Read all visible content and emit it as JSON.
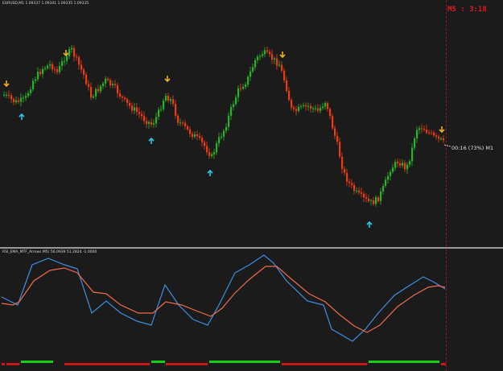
{
  "main_chart": {
    "title": "EURUSD,M1  1.09337 1.09341 1.09335 1.09335",
    "timer_label": "M5 : 3:18",
    "countdown_label": "00:16 (73%) M1"
  },
  "indicator": {
    "title": "RSI_EMA_MTF_Arrows M5) 56.0939 51.2824 -1.0000"
  },
  "colors": {
    "bull": "#27b427",
    "bear": "#ef3b12",
    "arrow_down": "#f2b01b",
    "arrow_up": "#24c8e6",
    "rsi": "#3d8fe0",
    "ema": "#f06a4a",
    "bar_green": "#16d016",
    "bar_red": "#cc1818"
  },
  "icons": {
    "down_arrow": "arrow-down-icon",
    "up_arrow": "arrow-up-icon"
  }
}
